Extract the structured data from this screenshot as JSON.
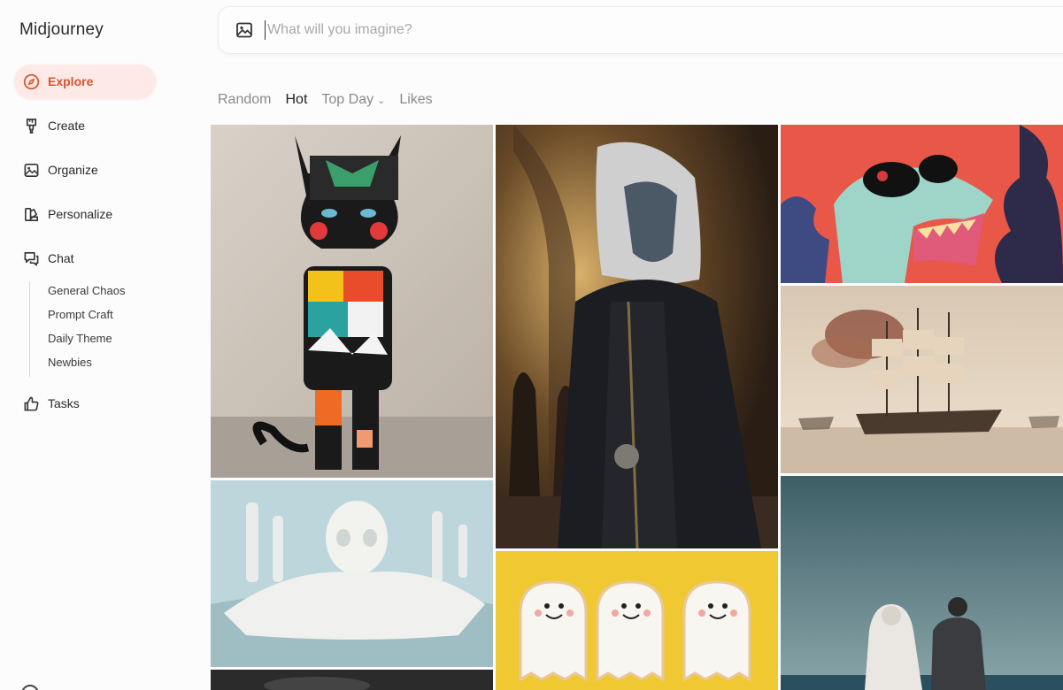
{
  "app": {
    "brand": "Midjourney"
  },
  "sidebar": {
    "items": [
      {
        "label": "Explore",
        "icon": "compass-icon",
        "active": true
      },
      {
        "label": "Create",
        "icon": "brush-icon"
      },
      {
        "label": "Organize",
        "icon": "image-icon"
      },
      {
        "label": "Personalize",
        "icon": "palette-icon"
      },
      {
        "label": "Chat",
        "icon": "chat-icon"
      },
      {
        "label": "Tasks",
        "icon": "thumbs-up-icon"
      }
    ],
    "chat_channels": [
      "General Chaos",
      "Prompt Craft",
      "Daily Theme",
      "Newbies"
    ]
  },
  "search": {
    "placeholder": "What will you imagine?",
    "value": "",
    "icon": "image-icon"
  },
  "filters": {
    "tabs": [
      {
        "label": "Random"
      },
      {
        "label": "Hot",
        "active": true
      },
      {
        "label": "Top Day",
        "dropdown": true
      },
      {
        "label": "Likes"
      }
    ]
  },
  "gallery": {
    "images": [
      {
        "name": "patterned-cat-figurine-image"
      },
      {
        "name": "pale-elf-warrior-image"
      },
      {
        "name": "crocodile-sunglasses-illustration-image"
      },
      {
        "name": "sailing-ship-painting-image"
      },
      {
        "name": "white-alien-sculpture-image"
      },
      {
        "name": "ghost-cookies-image"
      },
      {
        "name": "wedding-couple-sea-image"
      },
      {
        "name": "dark-partial-image"
      }
    ]
  },
  "colors": {
    "accent": "#d9532f",
    "active_bg": "#fdeae6"
  }
}
